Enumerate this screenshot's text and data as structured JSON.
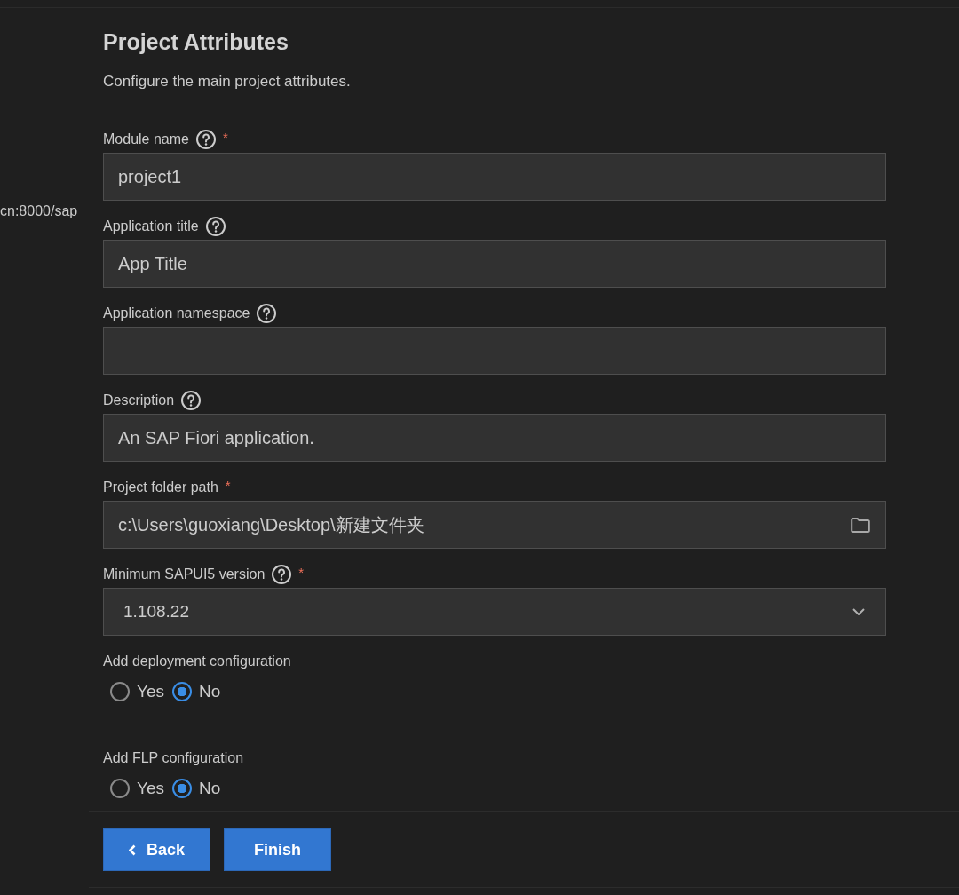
{
  "sidebar": {
    "text": "cn:8000/sap"
  },
  "header": {
    "title": "Project Attributes",
    "subtitle": "Configure the main project attributes."
  },
  "fields": [
    {
      "kind": "text",
      "label": "Module name",
      "help": true,
      "required_mark": "*",
      "value": "project1"
    },
    {
      "kind": "text",
      "label": "Application title",
      "help": true,
      "value": "App Title"
    },
    {
      "kind": "text",
      "label": "Application namespace",
      "help": true
    },
    {
      "kind": "text",
      "label": "Description",
      "help": true,
      "value": "An SAP Fiori application."
    },
    {
      "kind": "folder",
      "label": "Project folder path",
      "help": false,
      "required_mark": "*",
      "value": "c:\\Users\\guoxiang\\Desktop\\新建文件夹"
    },
    {
      "kind": "select",
      "label": "Minimum SAPUI5 version",
      "help": true,
      "required_mark": "*",
      "value": "1.108.22"
    }
  ],
  "radio_groups": [
    {
      "label": "Add deployment configuration",
      "options": [
        {
          "label": "Yes",
          "selected": false
        },
        {
          "label": "No",
          "selected": true
        }
      ]
    },
    {
      "label": "Add FLP configuration",
      "options": [
        {
          "label": "Yes",
          "selected": false
        },
        {
          "label": "No",
          "selected": true
        }
      ]
    }
  ],
  "buttons": [
    {
      "kind": "back",
      "label": "Back"
    },
    {
      "kind": "primary",
      "label": "Finish"
    }
  ]
}
